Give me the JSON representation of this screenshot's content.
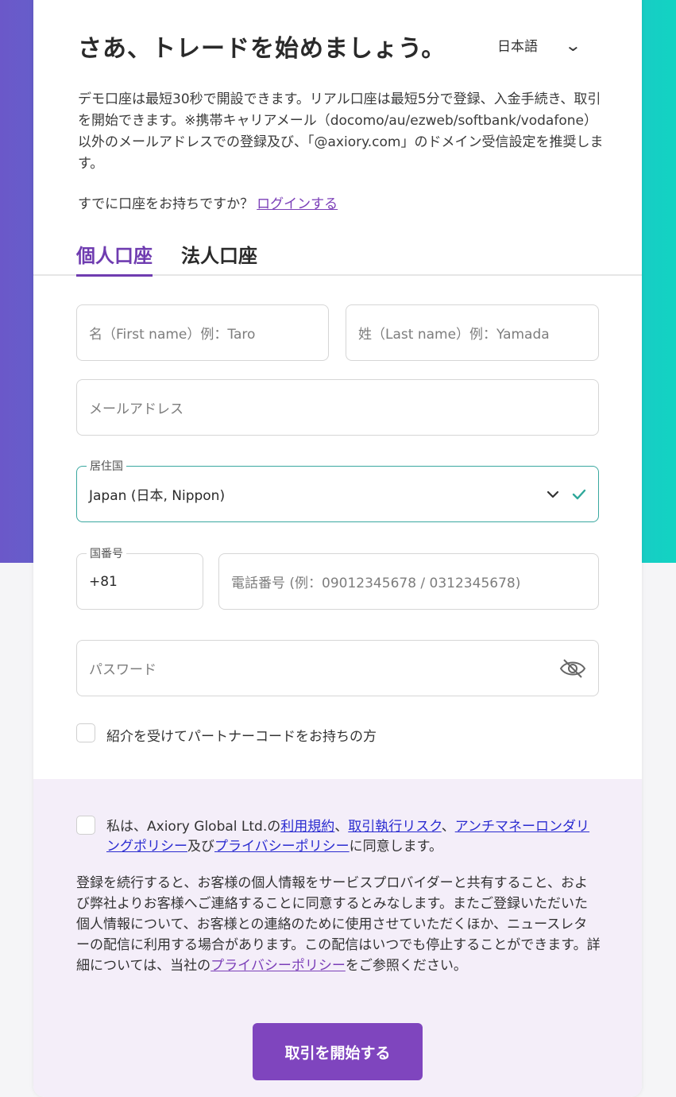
{
  "header": {
    "title": "さあ、トレードを始めましょう。",
    "language": "日本語"
  },
  "intro": {
    "text": "デモ口座は最短30秒で開設できます。リアル口座は最短5分で登録、入金手続き、取引を開始できます。※携帯キャリアメール（docomo/au/ezweb/softbank/vodafone）以外のメールアドレスでの登録及び、「@axiory.com」のドメイン受信設定を推奨します。",
    "login_prompt": "すでに口座をお持ちですか？",
    "login_link": "ログインする"
  },
  "tabs": [
    {
      "label": "個人口座",
      "active": true
    },
    {
      "label": "法人口座",
      "active": false
    }
  ],
  "form": {
    "first_name_placeholder": "名（First name）例：Taro",
    "last_name_placeholder": "姓（Last name）例：Yamada",
    "email_placeholder": "メールアドレス",
    "country_label": "居住国",
    "country_value": "Japan (日本, Nippon)",
    "country_code_label": "国番号",
    "country_code_value": "+81",
    "phone_placeholder": "電話番号 (例：09012345678 / 0312345678)",
    "password_placeholder": "パスワード",
    "partner_code_label": "紹介を受けてパートナーコードをお持ちの方"
  },
  "consent": {
    "prefix": "私は、Axiory Global Ltd.の",
    "link_terms": "利用規約",
    "sep1": "、",
    "link_risk": "取引執行リスク",
    "sep2": "、",
    "link_aml": "アンチマネーロンダリングポリシー",
    "and": "及び",
    "link_privacy": "プライバシーポリシー",
    "suffix": "に同意します。"
  },
  "notice": {
    "text": "登録を続行すると、お客様の個人情報をサービスプロバイダーと共有すること、および弊社よりお客様へご連絡することに同意するとみなします。またご登録いただいた個人情報について、お客様との連絡のために使用させていただくほか、ニュースレターの配信に利用する場合があります。この配信はいつでも停止することができます。詳細については、当社の",
    "link_privacy": "プライバシーポリシー",
    "suffix": "をご参照ください。"
  },
  "submit_label": "取引を開始する",
  "colors": {
    "accent": "#7f45be",
    "link_blue": "#2a2bd0",
    "valid_check": "#2fa89a"
  }
}
